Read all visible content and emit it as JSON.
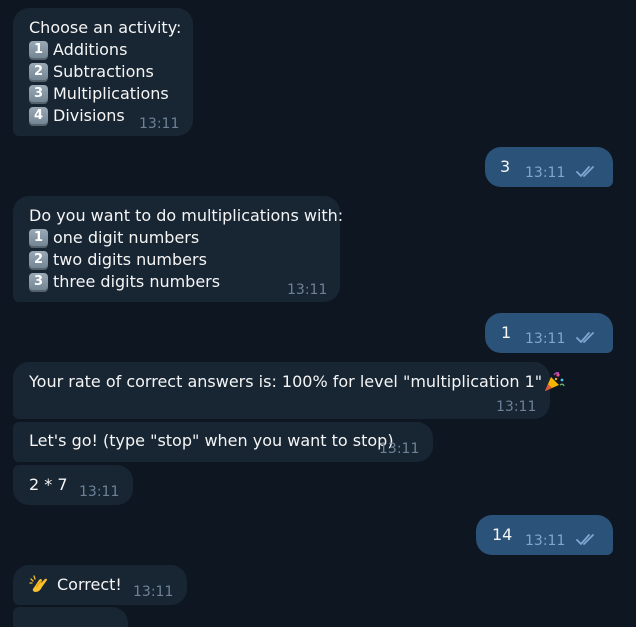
{
  "messages": {
    "m1": {
      "title": "Choose an activity:",
      "options": [
        {
          "key": "1",
          "label": "Additions"
        },
        {
          "key": "2",
          "label": "Subtractions"
        },
        {
          "key": "3",
          "label": "Multiplications"
        },
        {
          "key": "4",
          "label": "Divisions"
        }
      ],
      "time": "13:11"
    },
    "m2": {
      "text": "3",
      "time": "13:11"
    },
    "m3": {
      "title": "Do you want to do multiplications with:",
      "options": [
        {
          "key": "1",
          "label": "one digit numbers"
        },
        {
          "key": "2",
          "label": "two digits numbers"
        },
        {
          "key": "3",
          "label": "three digits numbers"
        }
      ],
      "time": "13:11"
    },
    "m4": {
      "text": "1",
      "time": "13:11"
    },
    "m5": {
      "text": "Your rate of correct answers is: 100% for level \"multiplication 1\"",
      "time": "13:11"
    },
    "m6": {
      "text": "Let's go! (type \"stop\" when you want to stop)",
      "time": "13:11"
    },
    "m7": {
      "text": "2 * 7",
      "time": "13:11"
    },
    "m8": {
      "text": "14",
      "time": "13:11"
    },
    "m9": {
      "text": "Correct!",
      "time": "13:11"
    }
  },
  "icons": {
    "read_check": "double-check-icon",
    "party": "party-popper-icon",
    "clap": "clapping-hands-icon"
  },
  "colors": {
    "background": "#0e1621",
    "incoming_bubble": "#182533",
    "outgoing_bubble": "#2b5278",
    "time_incoming": "#6d8298",
    "time_outgoing": "#7da8d3"
  }
}
